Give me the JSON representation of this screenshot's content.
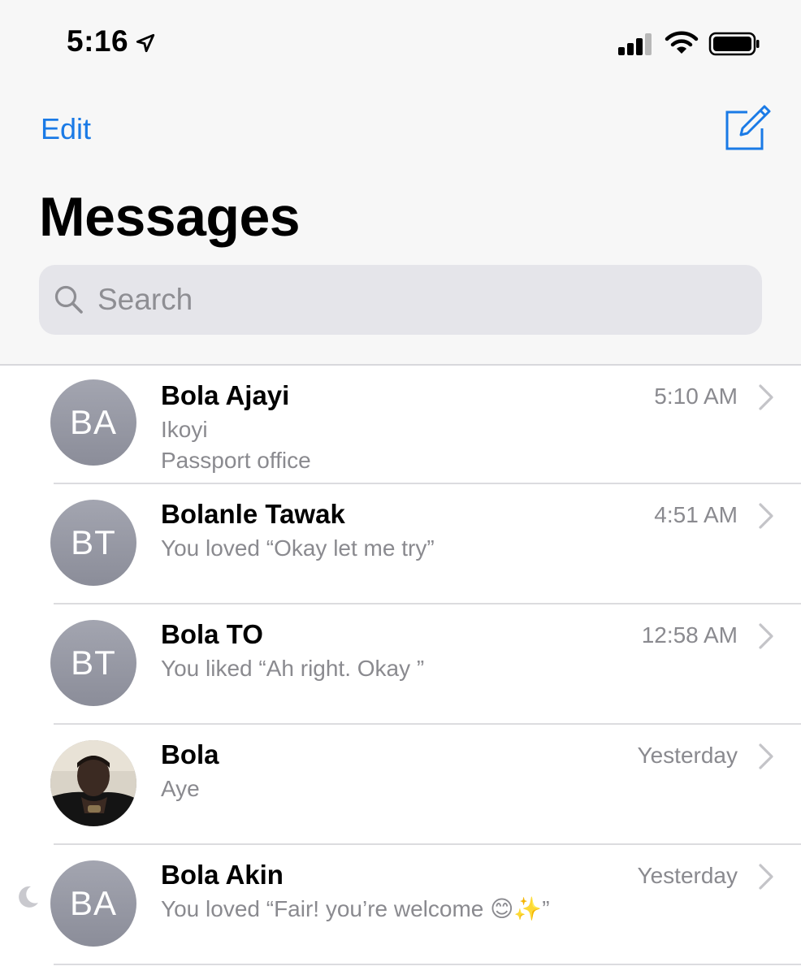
{
  "status_bar": {
    "time": "5:16",
    "icons": [
      "location-arrow-icon",
      "signal-bars-icon",
      "wifi-icon",
      "battery-icon"
    ]
  },
  "nav": {
    "edit_label": "Edit",
    "compose_icon": "compose-icon",
    "title": "Messages"
  },
  "search": {
    "placeholder": "Search",
    "icon": "search-icon"
  },
  "colors": {
    "accent": "#1a7ae6",
    "secondary_text": "#8a8a8f",
    "avatar_gray": "#9698a3",
    "search_bg": "#e5e5ea",
    "header_bg": "#f7f7f7"
  },
  "conversations": [
    {
      "initials": "BA",
      "name": "Bola Ajayi",
      "time": "5:10 AM",
      "preview": "Ikoyi\nPassport office",
      "photo": false,
      "muted": false
    },
    {
      "initials": "BT",
      "name": "Bolanle Tawak",
      "time": "4:51 AM",
      "preview": "You loved “Okay let me try”",
      "photo": false,
      "muted": false
    },
    {
      "initials": "BT",
      "name": "Bola TO",
      "time": "12:58 AM",
      "preview": "You liked “Ah right. Okay ”",
      "photo": false,
      "muted": false
    },
    {
      "initials": "",
      "name": "Bola",
      "time": "Yesterday",
      "preview": "Aye",
      "photo": true,
      "muted": false
    },
    {
      "initials": "BA",
      "name": "Bola Akin",
      "time": "Yesterday",
      "preview": "You loved “Fair! you’re welcome 😊✨”",
      "photo": false,
      "muted": true
    }
  ]
}
